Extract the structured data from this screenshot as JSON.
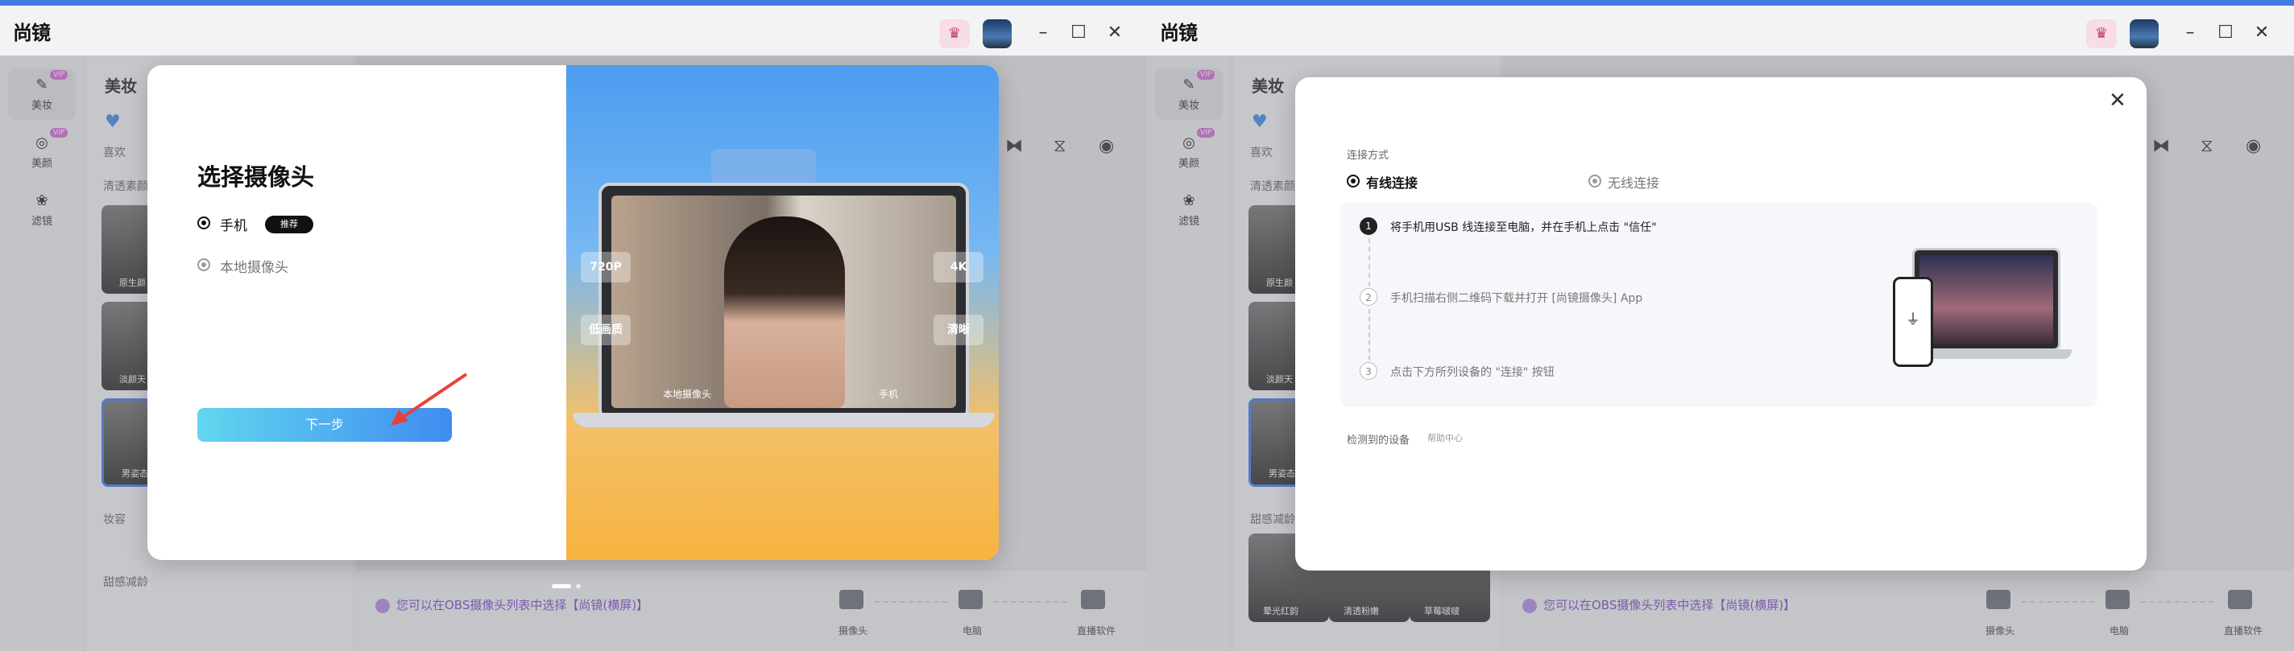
{
  "app": {
    "logo": "尚镜",
    "menu_icon": "menu-icon"
  },
  "rail": [
    {
      "label": "美妆",
      "vip": "VIP",
      "icon": "makeup-icon"
    },
    {
      "label": "美颜",
      "vip": "VIP",
      "icon": "beauty-icon"
    },
    {
      "label": "滤镜",
      "vip": "",
      "icon": "filter-icon"
    }
  ],
  "panel": {
    "title": "美妆",
    "favorites": "喜欢",
    "section1": "清透素颜",
    "section2": "妆容",
    "section3": "甜感减龄",
    "faces_left": [
      "原生颜",
      "淡颜天",
      "男姿态"
    ],
    "faces_right_a": [
      "原生颜",
      "淡颜天",
      "男姿态"
    ],
    "faces_right_b": [
      "晕光红韵",
      "清透粉嫩",
      "草莓啵啵"
    ]
  },
  "bottombar": {
    "obs_hint": "您可以在OBS摄像头列表中选择【尚镜(横屏)】",
    "devices": [
      "摄像头",
      "电脑",
      "直播软件"
    ]
  },
  "modal_camera": {
    "title": "选择摄像头",
    "option_phone": "手机",
    "recommend_badge": "推荐",
    "option_local": "本地摄像头",
    "next_label": "下一步",
    "tags": [
      "720P",
      "4K",
      "低画质",
      "清晰"
    ],
    "screen_labels": [
      "本地摄像头",
      "手机"
    ]
  },
  "modal_connect": {
    "section_label": "连接方式",
    "wired": "有线连接",
    "wireless": "无线连接",
    "steps": [
      {
        "num": "1",
        "text": "将手机用USB 线连接至电脑，并在手机上点击 \"信任\""
      },
      {
        "num": "2",
        "text": "手机扫描右侧二维码下载并打开 [尚镜摄像头] App"
      },
      {
        "num": "3",
        "text": "点击下方所列设备的 \"连接\" 按钮"
      }
    ],
    "detected_label": "检测到的设备",
    "help_link": "帮助中心"
  }
}
